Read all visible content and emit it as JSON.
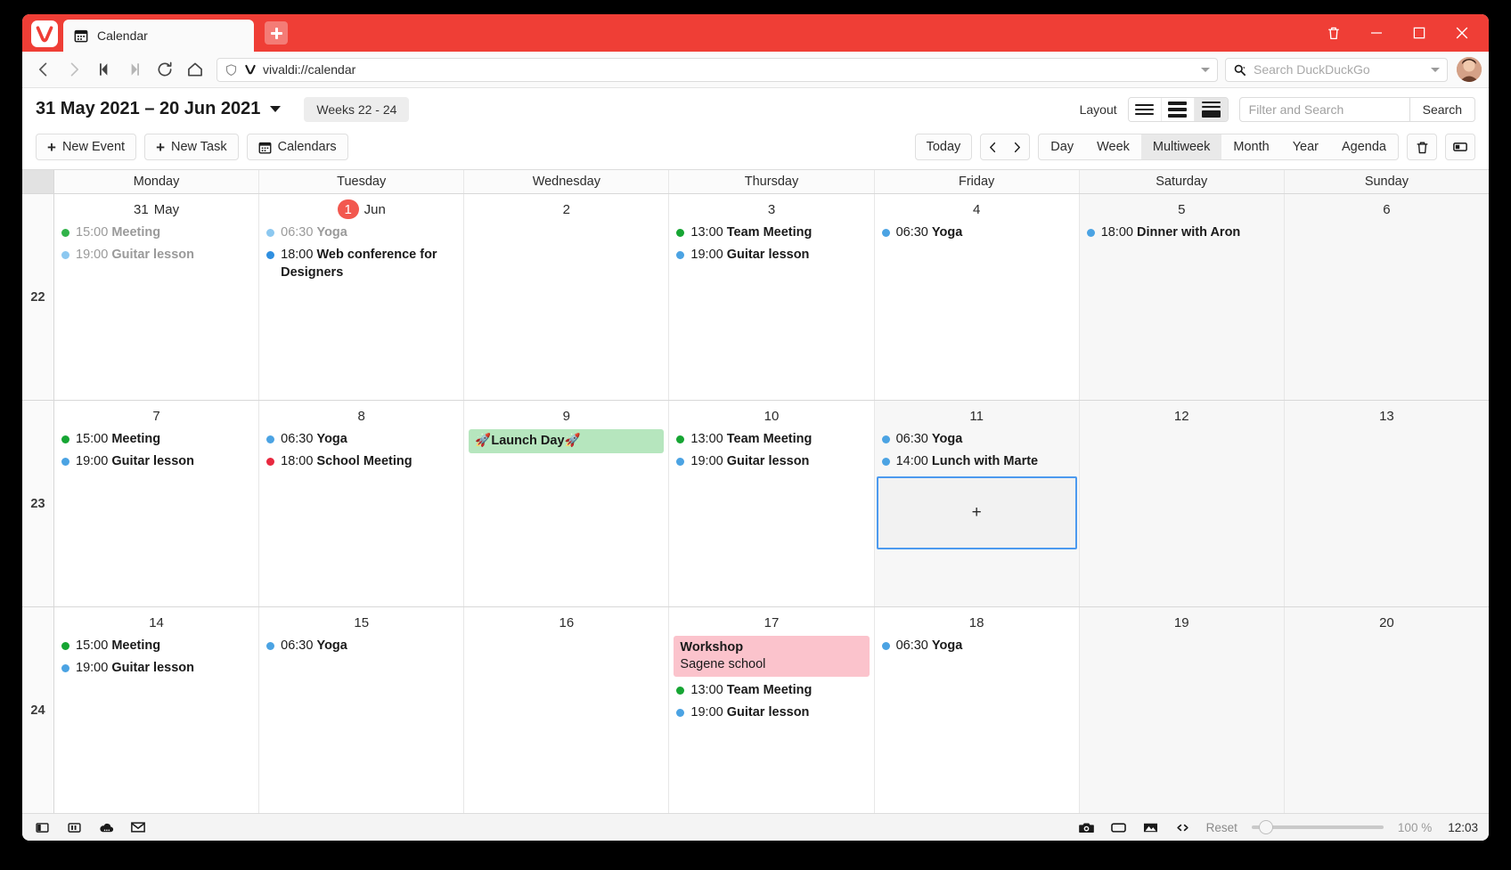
{
  "window": {
    "tab": {
      "title": "Calendar",
      "favicon_icon": "calendar-icon"
    },
    "new_tab_icon": "plus-icon",
    "controls": {
      "trash": "trash-icon",
      "minimize": "minimize-icon",
      "maximize": "maximize-icon",
      "close": "close-icon"
    }
  },
  "addressbar": {
    "back_icon": "back-arrow-icon",
    "forward_icon": "forward-arrow-icon",
    "rewind_icon": "rewind-icon",
    "fastforward_icon": "fast-forward-icon",
    "reload_icon": "reload-icon",
    "home_icon": "home-icon",
    "shield_icon": "shield-icon",
    "vivaldi_icon": "vivaldi-v-icon",
    "url": "vivaldi://calendar",
    "dropdown_icon": "chevron-down-icon",
    "search_icon": "search-magnifier-icon",
    "search_placeholder": "Search DuckDuckGo"
  },
  "calendar_header": {
    "date_range": "31 May 2021 – 20 Jun 2021",
    "range_dropdown_icon": "chevron-down-icon",
    "weeks_label": "Weeks 22 - 24",
    "layout_label": "Layout",
    "layout_options": [
      "compact",
      "medium",
      "comfortable"
    ],
    "layout_active_index": 2,
    "filter_placeholder": "Filter and Search",
    "search_button": "Search"
  },
  "toolbar": {
    "new_event": "New Event",
    "new_task": "New Task",
    "calendars": "Calendars",
    "calendars_icon": "calendar-icon",
    "today": "Today",
    "prev_icon": "chevron-left-icon",
    "next_icon": "chevron-right-icon",
    "views": [
      "Day",
      "Week",
      "Multiweek",
      "Month",
      "Year",
      "Agenda"
    ],
    "active_view": "Multiweek",
    "delete_icon": "trash-icon",
    "panel_icon": "event-panel-icon"
  },
  "grid": {
    "day_headers": [
      "Monday",
      "Tuesday",
      "Wednesday",
      "Thursday",
      "Friday",
      "Saturday",
      "Sunday"
    ],
    "weeks": [
      {
        "week_number": "22",
        "days": [
          {
            "num": "31",
            "month": "May",
            "today": false,
            "weekend": false,
            "events": [
              {
                "kind": "dot",
                "time": "15:00",
                "title": "Meeting",
                "color": "#31B34A",
                "past": true
              },
              {
                "kind": "dot",
                "time": "19:00",
                "title": "Guitar lesson",
                "color": "#8CC8F0",
                "past": true
              }
            ]
          },
          {
            "num": "1",
            "month": "Jun",
            "today": true,
            "weekend": false,
            "events": [
              {
                "kind": "dot",
                "time": "06:30",
                "title": "Yoga",
                "color": "#8CC8F0",
                "past": true
              },
              {
                "kind": "dot",
                "time": "18:00",
                "title": "Web conference for Designers",
                "color": "#2F8FE0",
                "past": false
              }
            ]
          },
          {
            "num": "2",
            "month": "",
            "today": false,
            "weekend": false,
            "events": []
          },
          {
            "num": "3",
            "month": "",
            "today": false,
            "weekend": false,
            "events": [
              {
                "kind": "dot",
                "time": "13:00",
                "title": "Team Meeting",
                "color": "#16A533",
                "past": false
              },
              {
                "kind": "dot",
                "time": "19:00",
                "title": "Guitar lesson",
                "color": "#4BA3E3",
                "past": false
              }
            ]
          },
          {
            "num": "4",
            "month": "",
            "today": false,
            "weekend": false,
            "events": [
              {
                "kind": "dot",
                "time": "06:30",
                "title": "Yoga",
                "color": "#4BA3E3",
                "past": false
              }
            ]
          },
          {
            "num": "5",
            "month": "",
            "today": false,
            "weekend": true,
            "events": [
              {
                "kind": "dot",
                "time": "18:00",
                "title": "Dinner with Aron",
                "color": "#4BA3E3",
                "past": false
              }
            ]
          },
          {
            "num": "6",
            "month": "",
            "today": false,
            "weekend": true,
            "events": []
          }
        ]
      },
      {
        "week_number": "23",
        "days": [
          {
            "num": "7",
            "month": "",
            "today": false,
            "weekend": false,
            "events": [
              {
                "kind": "dot",
                "time": "15:00",
                "title": "Meeting",
                "color": "#16A533",
                "past": false
              },
              {
                "kind": "dot",
                "time": "19:00",
                "title": "Guitar lesson",
                "color": "#4BA3E3",
                "past": false
              }
            ]
          },
          {
            "num": "8",
            "month": "",
            "today": false,
            "weekend": false,
            "events": [
              {
                "kind": "dot",
                "time": "06:30",
                "title": "Yoga",
                "color": "#4BA3E3",
                "past": false
              },
              {
                "kind": "dot",
                "time": "18:00",
                "title": "School Meeting",
                "color": "#E8283F",
                "past": false
              }
            ]
          },
          {
            "num": "9",
            "month": "",
            "today": false,
            "weekend": false,
            "events": [
              {
                "kind": "block",
                "title": "🚀Launch Day🚀",
                "subtitle": "",
                "bg": "#B6E6BE"
              }
            ]
          },
          {
            "num": "10",
            "month": "",
            "today": false,
            "weekend": false,
            "events": [
              {
                "kind": "dot",
                "time": "13:00",
                "title": "Team Meeting",
                "color": "#16A533",
                "past": false
              },
              {
                "kind": "dot",
                "time": "19:00",
                "title": "Guitar lesson",
                "color": "#4BA3E3",
                "past": false
              }
            ]
          },
          {
            "num": "11",
            "month": "",
            "today": false,
            "weekend": false,
            "selected": true,
            "add_slot_label": "+",
            "events": [
              {
                "kind": "dot",
                "time": "06:30",
                "title": "Yoga",
                "color": "#4BA3E3",
                "past": false
              },
              {
                "kind": "dot",
                "time": "14:00",
                "title": "Lunch with Marte",
                "color": "#4BA3E3",
                "past": false
              }
            ]
          },
          {
            "num": "12",
            "month": "",
            "today": false,
            "weekend": true,
            "events": []
          },
          {
            "num": "13",
            "month": "",
            "today": false,
            "weekend": true,
            "events": []
          }
        ]
      },
      {
        "week_number": "24",
        "days": [
          {
            "num": "14",
            "month": "",
            "today": false,
            "weekend": false,
            "events": [
              {
                "kind": "dot",
                "time": "15:00",
                "title": "Meeting",
                "color": "#16A533",
                "past": false
              },
              {
                "kind": "dot",
                "time": "19:00",
                "title": "Guitar lesson",
                "color": "#4BA3E3",
                "past": false
              }
            ]
          },
          {
            "num": "15",
            "month": "",
            "today": false,
            "weekend": false,
            "events": [
              {
                "kind": "dot",
                "time": "06:30",
                "title": "Yoga",
                "color": "#4BA3E3",
                "past": false
              }
            ]
          },
          {
            "num": "16",
            "month": "",
            "today": false,
            "weekend": false,
            "events": []
          },
          {
            "num": "17",
            "month": "",
            "today": false,
            "weekend": false,
            "events": [
              {
                "kind": "block",
                "title": "Workshop",
                "subtitle": "Sagene school",
                "bg": "#FBC3CC"
              },
              {
                "kind": "dot",
                "time": "13:00",
                "title": "Team Meeting",
                "color": "#16A533",
                "past": false
              },
              {
                "kind": "dot",
                "time": "19:00",
                "title": "Guitar lesson",
                "color": "#4BA3E3",
                "past": false
              }
            ]
          },
          {
            "num": "18",
            "month": "",
            "today": false,
            "weekend": false,
            "events": [
              {
                "kind": "dot",
                "time": "06:30",
                "title": "Yoga",
                "color": "#4BA3E3",
                "past": false
              }
            ]
          },
          {
            "num": "19",
            "month": "",
            "today": false,
            "weekend": true,
            "events": []
          },
          {
            "num": "20",
            "month": "",
            "today": false,
            "weekend": true,
            "events": []
          }
        ]
      }
    ]
  },
  "statusbar": {
    "panel_icon": "side-panel-icon",
    "tiling_icon": "tile-icon",
    "cloud_icon": "sync-cloud-icon",
    "mail_icon": "mail-icon",
    "capture_icon": "camera-capture-icon",
    "window_icon": "window-icon",
    "images_icon": "image-toggle-icon",
    "code_icon": "developer-code-icon",
    "reset_label": "Reset",
    "zoom_level": "100 %",
    "clock": "12:03"
  }
}
